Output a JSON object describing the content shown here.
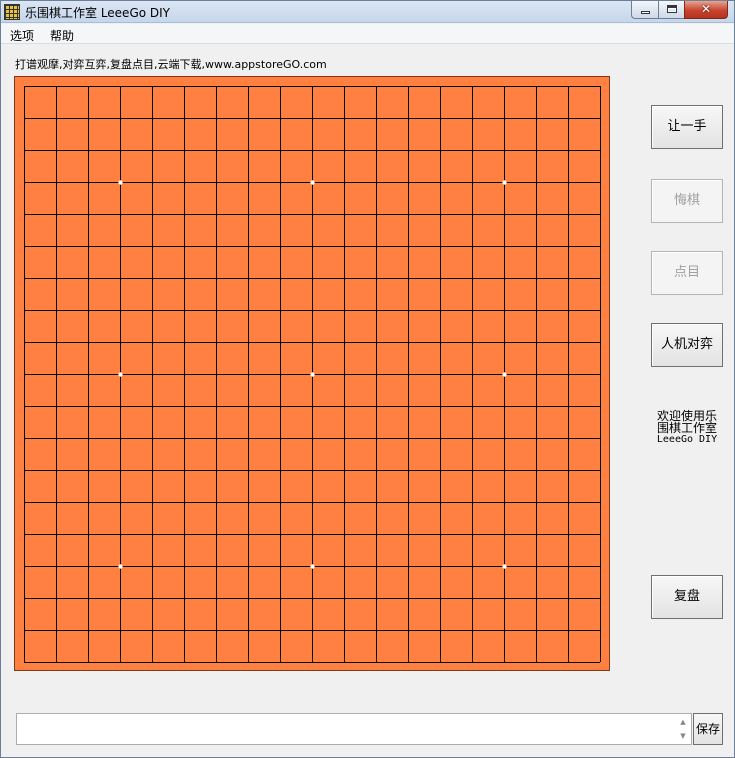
{
  "window": {
    "title": "乐围棋工作室 LeeeGo DIY",
    "close_glyph": "✕"
  },
  "menu": {
    "items": [
      "选项",
      "帮助"
    ]
  },
  "info_line": "打谱观摩,对弈互弈,复盘点目,云端下载,www.appstoreGO.com",
  "board": {
    "size": 19,
    "color": "#ff8040",
    "line_color": "#000000",
    "star_point_color": "#ffffff",
    "star_points": [
      [
        3,
        3
      ],
      [
        3,
        9
      ],
      [
        3,
        15
      ],
      [
        9,
        3
      ],
      [
        9,
        9
      ],
      [
        9,
        15
      ],
      [
        15,
        3
      ],
      [
        15,
        9
      ],
      [
        15,
        15
      ]
    ]
  },
  "side_buttons": {
    "handicap": "让一手",
    "undo": "悔棋",
    "count": "点目",
    "vs_ai": "人机对弈",
    "review": "复盘"
  },
  "welcome": {
    "line1": "欢迎使用乐",
    "line2": "围棋工作室",
    "line3": "LeeeGo DIY"
  },
  "bottom": {
    "comment_value": "",
    "save_label": "保存",
    "scroll_up_glyph": "▲",
    "scroll_down_glyph": "▼"
  }
}
